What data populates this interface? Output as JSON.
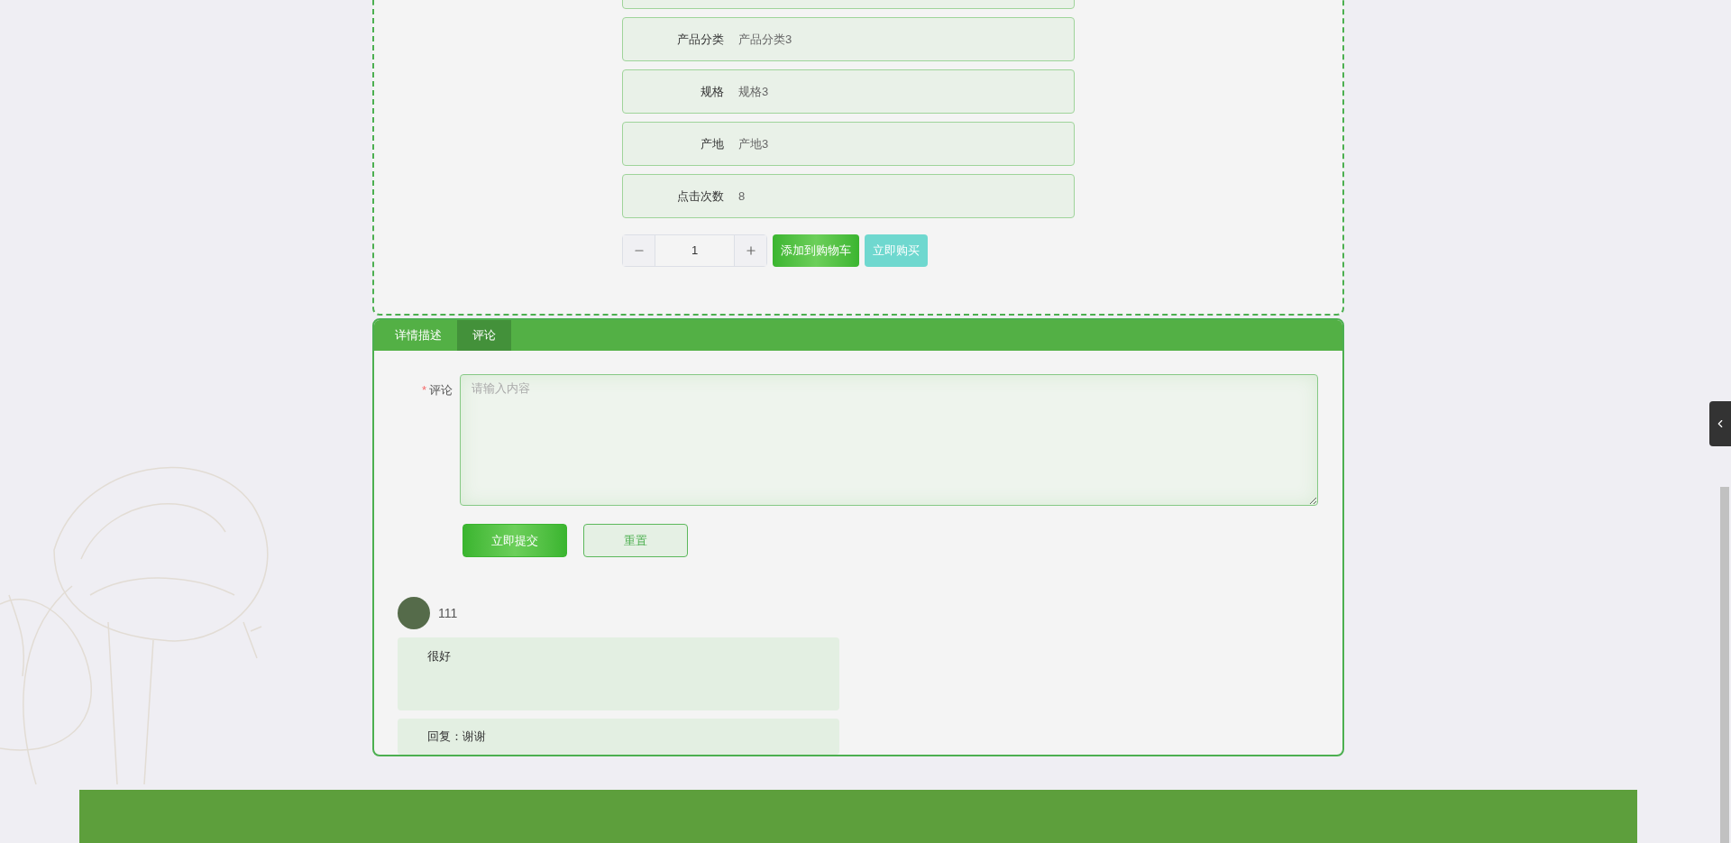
{
  "product_fields": [
    {
      "label": "产品分类",
      "value": "产品分类3"
    },
    {
      "label": "规格",
      "value": "规格3"
    },
    {
      "label": "产地",
      "value": "产地3"
    },
    {
      "label": "点击次数",
      "value": "8"
    }
  ],
  "quantity": {
    "value": "1"
  },
  "actions": [
    {
      "label": "添加到购物车",
      "kind": "cart"
    },
    {
      "label": "立即购买",
      "kind": "buy"
    }
  ],
  "tabs": [
    {
      "label": "详情描述",
      "selected": false
    },
    {
      "label": "评论",
      "selected": true
    }
  ],
  "comment_form": {
    "label": "评论",
    "required_mark": "*",
    "placeholder": "请输入内容",
    "buttons": [
      {
        "label": "立即提交",
        "kind": "primary"
      },
      {
        "label": "重置",
        "kind": "secondary"
      }
    ]
  },
  "comments": [
    {
      "user": "111",
      "content": "很好",
      "reply": "回复：谢谢"
    }
  ]
}
